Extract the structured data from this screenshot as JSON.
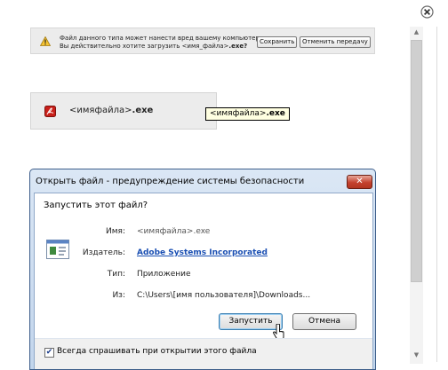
{
  "warning_bar": {
    "line1": "Файл данного типа может нанести вред вашему компьютеру.",
    "line2_prefix": "Вы действительно хотите загрузить ",
    "line2_file": "<имя_файла>",
    "line2_suffix": ".exe?",
    "save_label": "Сохранить",
    "cancel_label": "Отменить передачу",
    "icon": "warning-triangle-icon"
  },
  "download_item": {
    "icon": "pdf-file-icon",
    "name_base": "<имяфайла>",
    "name_ext": ".exe",
    "tooltip_base": "<имяфайла>",
    "tooltip_ext": ".exe"
  },
  "dialog": {
    "title": "Открыть файл - предупреждение системы безопасности",
    "close_glyph": "✕",
    "question": "Запустить этот файл?",
    "name_label": "Имя:",
    "name_value": "<имяфайла>.exe",
    "publisher_label": "Издатель:",
    "publisher_value": "Adobe Systems Incorporated",
    "type_label": "Тип:",
    "type_value": "Приложение",
    "from_label": "Из:",
    "from_value": "C:\\Users\\[имя пользователя]\\Downloads...",
    "run_label": "Запустить",
    "cancel_label": "Отмена",
    "always_ask_label": "Всегда спрашивать при открытии этого файла",
    "always_ask_checked": true,
    "check_glyph": "✔"
  },
  "panel": {
    "close_icon": "close-circle-icon",
    "scroll_up_glyph": "▲",
    "scroll_down_glyph": "▼"
  },
  "colors": {
    "publisher_link": "#1a4fb3",
    "title_bar": "#c2d5ec",
    "close_button": "#c4422f",
    "tooltip_bg": "#ffffe1"
  }
}
